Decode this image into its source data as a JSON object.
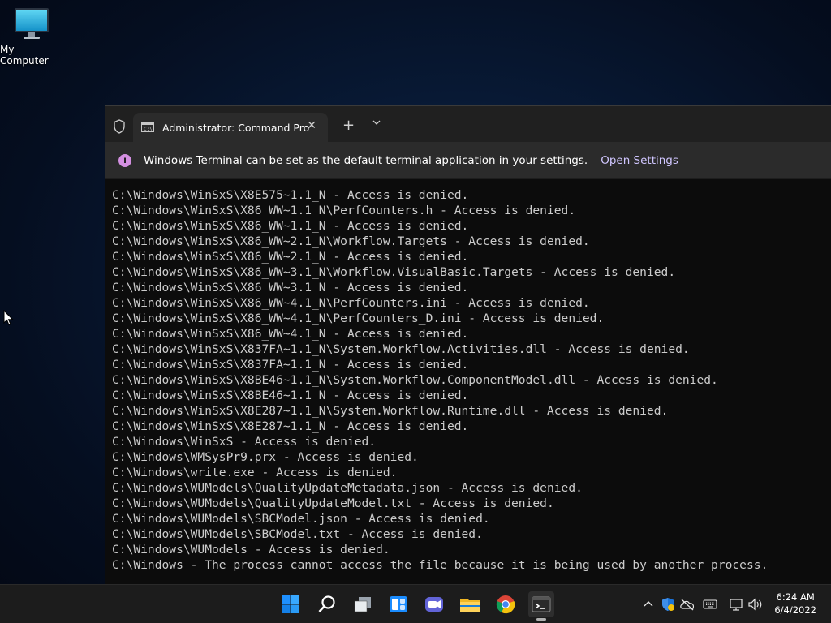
{
  "desktop": {
    "icons": [
      {
        "label": "My Computer",
        "icon": "monitor-icon"
      }
    ]
  },
  "terminal": {
    "tab_title": "Administrator: Command Pro",
    "new_tab_label": "+",
    "close_label": "✕",
    "dropdown_label": "⌄",
    "infobar": {
      "message": "Windows Terminal can be set as the default terminal application in your settings.",
      "link": "Open Settings"
    },
    "lines": [
      "C:\\Windows\\WinSxS\\X8E575~1.1_N - Access is denied.",
      "C:\\Windows\\WinSxS\\X86_WW~1.1_N\\PerfCounters.h - Access is denied.",
      "C:\\Windows\\WinSxS\\X86_WW~1.1_N - Access is denied.",
      "C:\\Windows\\WinSxS\\X86_WW~2.1_N\\Workflow.Targets - Access is denied.",
      "C:\\Windows\\WinSxS\\X86_WW~2.1_N - Access is denied.",
      "C:\\Windows\\WinSxS\\X86_WW~3.1_N\\Workflow.VisualBasic.Targets - Access is denied.",
      "C:\\Windows\\WinSxS\\X86_WW~3.1_N - Access is denied.",
      "C:\\Windows\\WinSxS\\X86_WW~4.1_N\\PerfCounters.ini - Access is denied.",
      "C:\\Windows\\WinSxS\\X86_WW~4.1_N\\PerfCounters_D.ini - Access is denied.",
      "C:\\Windows\\WinSxS\\X86_WW~4.1_N - Access is denied.",
      "C:\\Windows\\WinSxS\\X837FA~1.1_N\\System.Workflow.Activities.dll - Access is denied.",
      "C:\\Windows\\WinSxS\\X837FA~1.1_N - Access is denied.",
      "C:\\Windows\\WinSxS\\X8BE46~1.1_N\\System.Workflow.ComponentModel.dll - Access is denied.",
      "C:\\Windows\\WinSxS\\X8BE46~1.1_N - Access is denied.",
      "C:\\Windows\\WinSxS\\X8E287~1.1_N\\System.Workflow.Runtime.dll - Access is denied.",
      "C:\\Windows\\WinSxS\\X8E287~1.1_N - Access is denied.",
      "C:\\Windows\\WinSxS - Access is denied.",
      "C:\\Windows\\WMSysPr9.prx - Access is denied.",
      "C:\\Windows\\write.exe - Access is denied.",
      "C:\\Windows\\WUModels\\QualityUpdateMetadata.json - Access is denied.",
      "C:\\Windows\\WUModels\\QualityUpdateModel.txt - Access is denied.",
      "C:\\Windows\\WUModels\\SBCModel.json - Access is denied.",
      "C:\\Windows\\WUModels\\SBCModel.txt - Access is denied.",
      "C:\\Windows\\WUModels - Access is denied.",
      "C:\\Windows - The process cannot access the file because it is being used by another process."
    ]
  },
  "taskbar": {
    "apps": [
      "start-icon",
      "search-icon",
      "task-view-icon",
      "widgets-icon",
      "chat-icon",
      "file-explorer-icon",
      "chrome-icon",
      "terminal-icon"
    ],
    "tray": [
      "chevron-up-icon",
      "security-icon",
      "onedrive-icon",
      "keyboard-icon",
      "network-icon",
      "volume-icon"
    ],
    "time": "6:24 AM",
    "date": "6/4/2022"
  },
  "colors": {
    "accent": "#0078d4",
    "info_icon": "#d38fe0",
    "terminal_bg": "#0c0c0c",
    "terminal_text": "#cccccc"
  }
}
